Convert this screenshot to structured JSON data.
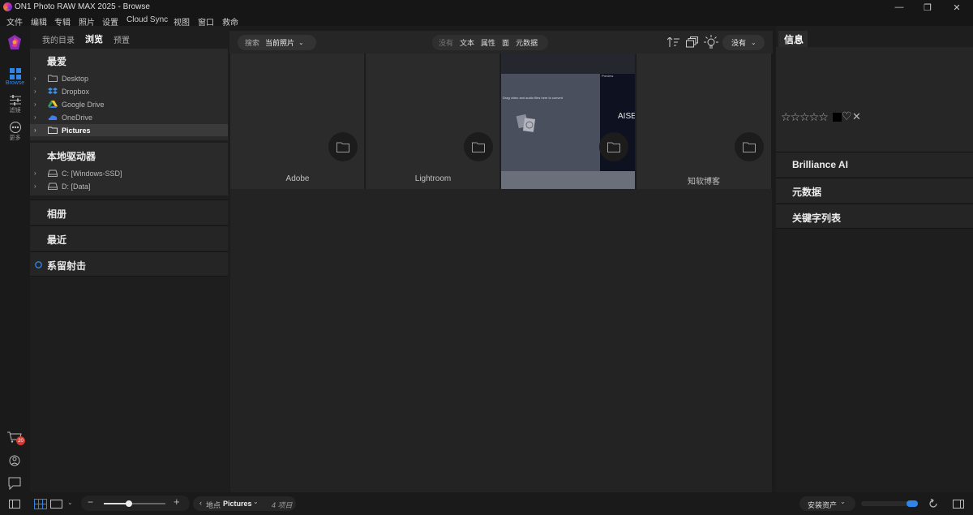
{
  "window": {
    "title": "ON1 Photo RAW MAX 2025 - Browse",
    "min_glyph": "—",
    "max_glyph": "❐",
    "close_glyph": "✕"
  },
  "menu": [
    "文件",
    "编辑",
    "专辑",
    "照片",
    "设置",
    "Cloud Sync",
    "视图",
    "窗口",
    "救命"
  ],
  "left_rail": {
    "browse_label": "Browse",
    "filters_label": "滤镜",
    "more_label": "更多",
    "cart_badge": "20"
  },
  "left_panel": {
    "tabs": [
      "我的目录",
      "浏览",
      "预置"
    ],
    "favorites": {
      "title": "最爱",
      "items": [
        {
          "label": "Desktop",
          "icon": "folder-icon"
        },
        {
          "label": "Dropbox",
          "icon": "dropbox-icon"
        },
        {
          "label": "Google Drive",
          "icon": "google-drive-icon"
        },
        {
          "label": "OneDrive",
          "icon": "onedrive-icon"
        },
        {
          "label": "Pictures",
          "icon": "folder-icon"
        }
      ]
    },
    "local_drives": {
      "title": "本地驱动器",
      "items": [
        {
          "label": "C: [Windows-SSD]"
        },
        {
          "label": "D: [Data]"
        }
      ]
    },
    "albums_title": "相册",
    "recent_title": "最近",
    "tether_title": "系留射击"
  },
  "toolbar": {
    "search_label": "搜索",
    "search_scope": "当前照片",
    "filters": [
      "没有",
      "文本",
      "属性",
      "面",
      "元数据"
    ],
    "sort_value": "没有"
  },
  "grid": {
    "folders": [
      "Adobe",
      "Lightroom",
      "",
      "知软博客"
    ],
    "thumb_text_drop": "Drag video and audio files here to convert",
    "thumb_text_brand": "AISE",
    "thumb_text_preview": "Preview"
  },
  "right_panel": {
    "tab": "信息",
    "rating_stars": "☆☆☆☆☆",
    "heart": "♡",
    "reject": "✕",
    "sections": [
      "Brilliance AI",
      "元数据",
      "关键字列表"
    ]
  },
  "bottom": {
    "location_label": "地点",
    "location_value": "Pictures",
    "items_count": "4 项目",
    "install_assets": "安装资产"
  },
  "colors": {
    "accent": "#2f86e8",
    "badge": "#d9362c"
  }
}
